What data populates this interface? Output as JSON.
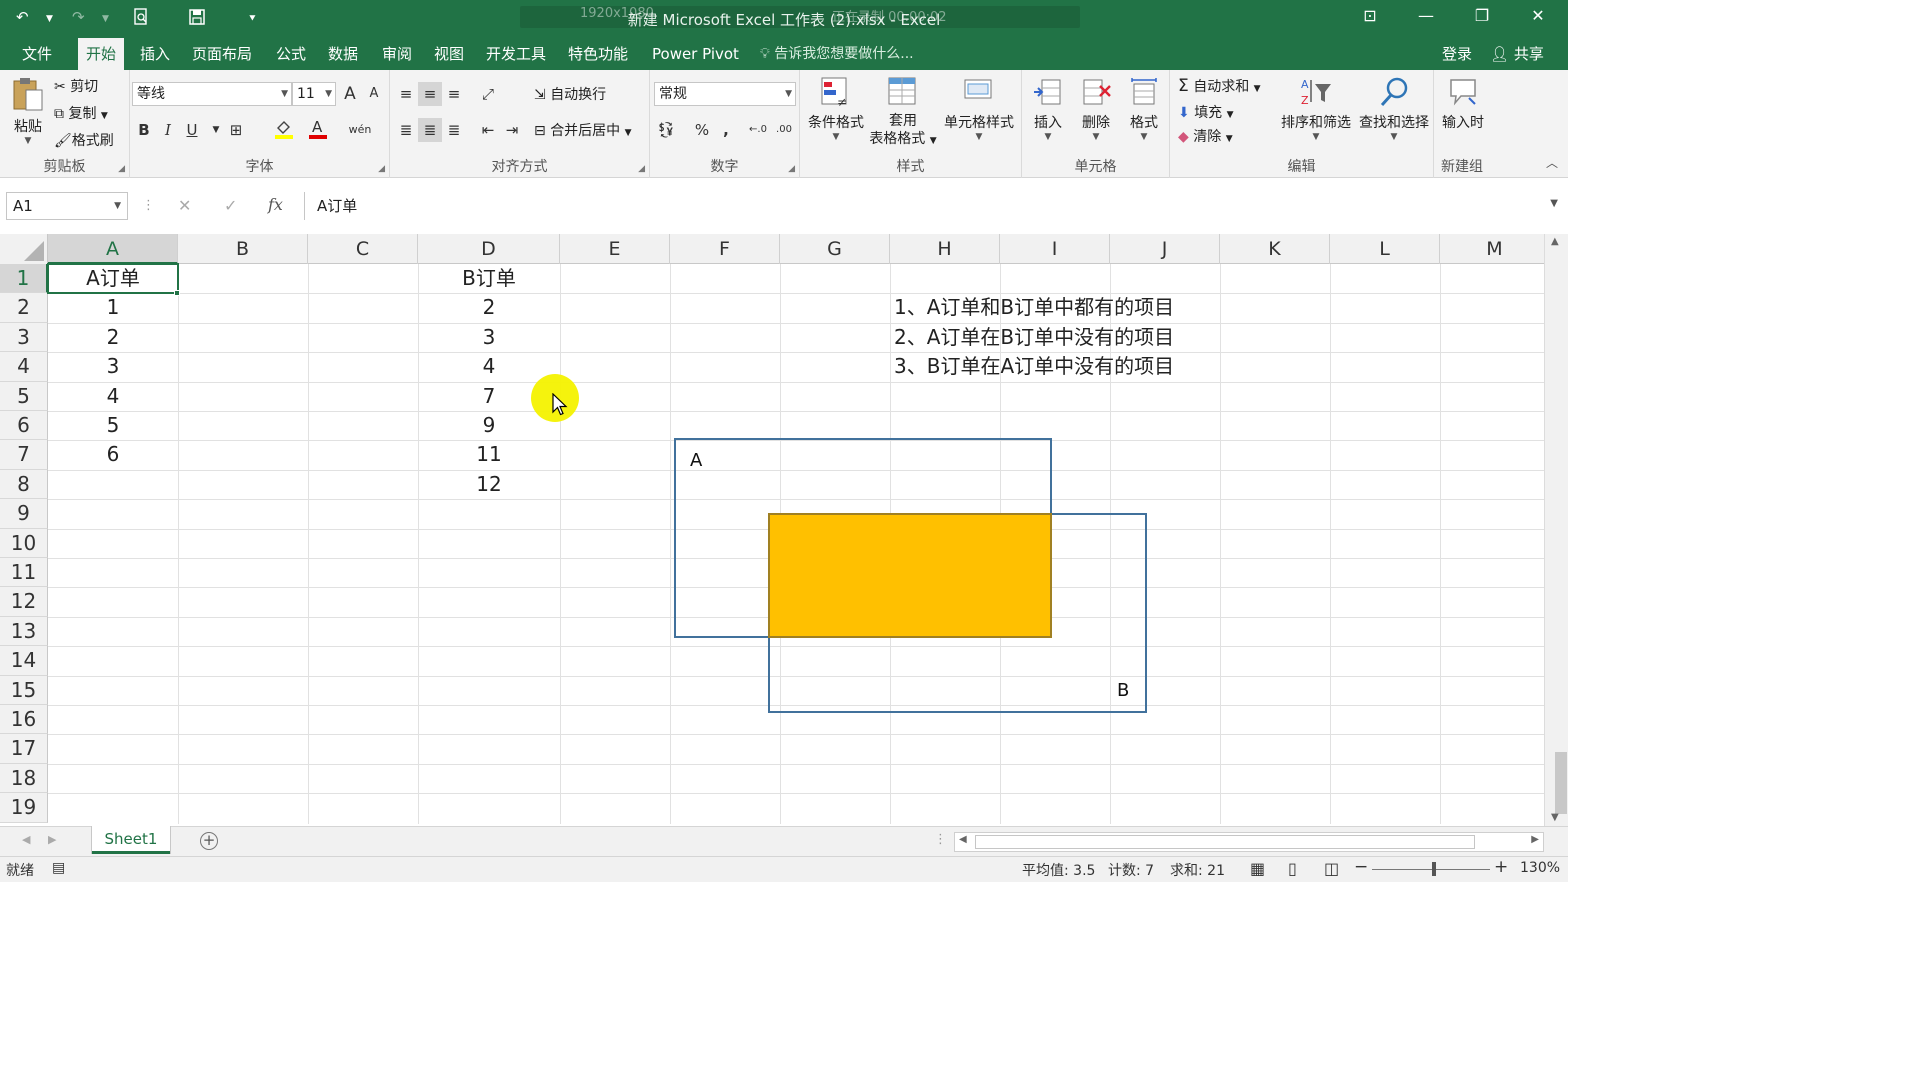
{
  "window": {
    "title": "新建 Microsoft Excel 工作表 (2).xlsx - Excel",
    "overlay_left": "1920x1080",
    "overlay_right": "正在录制 00:00:02"
  },
  "tabs": [
    "文件",
    "开始",
    "插入",
    "页面布局",
    "公式",
    "数据",
    "审阅",
    "视图",
    "开发工具",
    "特色功能",
    "Power Pivot"
  ],
  "tellme": "告诉我您想要做什么...",
  "signin": "登录",
  "share": "共享",
  "ribbon": {
    "clipboard": {
      "paste": "粘贴",
      "cut": "剪切",
      "copy": "复制",
      "format_painter": "格式刷",
      "label": "剪贴板"
    },
    "font": {
      "name": "等线",
      "size": "11",
      "label": "字体",
      "bold": "B",
      "italic": "I",
      "underline": "U",
      "grow": "A",
      "shrink": "A",
      "phonetic": "wén"
    },
    "alignment": {
      "wrap": "自动换行",
      "merge": "合并后居中",
      "label": "对齐方式"
    },
    "number": {
      "format": "常规",
      "percent": "%",
      "comma": ",",
      "label": "数字"
    },
    "styles": {
      "conditional": "条件格式",
      "table_line1": "套用",
      "table_line2": "表格格式",
      "cell_styles": "单元格样式",
      "label": "样式"
    },
    "cells": {
      "insert": "插入",
      "delete": "删除",
      "format": "格式",
      "label": "单元格"
    },
    "editing": {
      "autosum": "自动求和",
      "fill": "填充",
      "clear": "清除",
      "sort": "排序和筛选",
      "find": "查找和选择",
      "label": "编辑"
    },
    "newgroup": {
      "input": "输入时",
      "label": "新建组"
    }
  },
  "formula_bar": {
    "name_box": "A1",
    "formula": "A订单"
  },
  "columns": [
    "A",
    "B",
    "C",
    "D",
    "E",
    "F",
    "G",
    "H",
    "I",
    "J",
    "K",
    "L",
    "M"
  ],
  "rows": [
    "1",
    "2",
    "3",
    "4",
    "5",
    "6",
    "7",
    "8",
    "9",
    "10",
    "11",
    "12",
    "13",
    "14",
    "15",
    "16",
    "17",
    "18",
    "19"
  ],
  "cells": {
    "A1": "A订单",
    "A2": "1",
    "A3": "2",
    "A4": "3",
    "A5": "4",
    "A6": "5",
    "A7": "6",
    "D1": "B订单",
    "D2": "2",
    "D3": "3",
    "D4": "4",
    "D5": "7",
    "D6": "9",
    "D7": "11",
    "D8": "12",
    "H2": "1、A订单和B订单中都有的项目",
    "H3": "2、A订单在B订单中没有的项目",
    "H4": "3、B订单在A订单中没有的项目"
  },
  "shapes": {
    "label_a": "A",
    "label_b": "B",
    "overlap_color": "#ffc000",
    "outline_color": "#41719c"
  },
  "sheet": {
    "tab": "Sheet1"
  },
  "status": {
    "ready": "就绪",
    "average": "平均值: 3.5",
    "count": "计数: 7",
    "sum": "求和: 21",
    "zoom": "130%"
  },
  "colors": {
    "brand": "#217346",
    "accent_fill": "#ffc000"
  }
}
